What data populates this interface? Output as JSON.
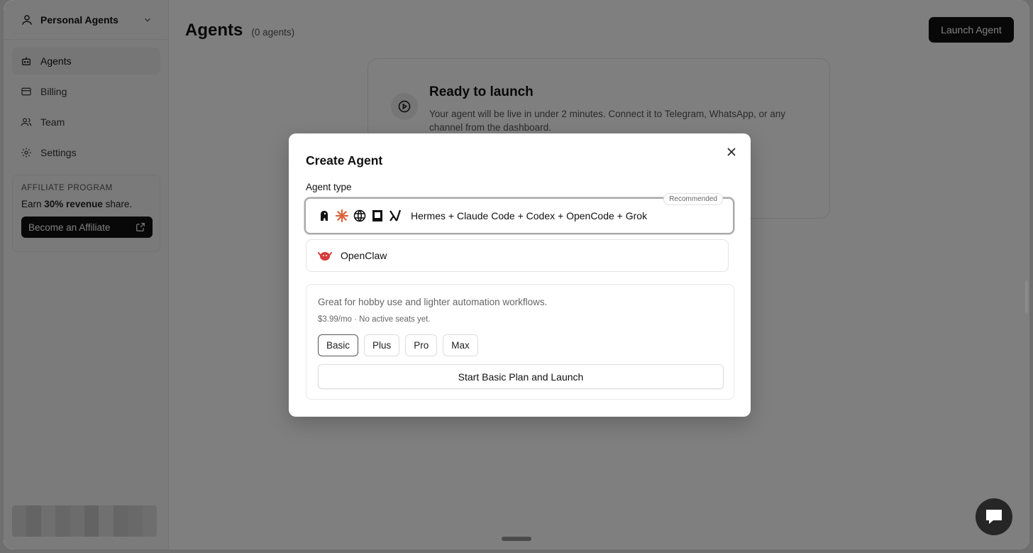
{
  "sidebar": {
    "workspace": "Personal Agents",
    "items": [
      {
        "label": "Agents",
        "icon": "robot-icon"
      },
      {
        "label": "Billing",
        "icon": "credit-card-icon"
      },
      {
        "label": "Team",
        "icon": "users-icon"
      },
      {
        "label": "Settings",
        "icon": "gear-icon"
      }
    ],
    "affiliate": {
      "kicker": "AFFILIATE PROGRAM",
      "text_pre": "Earn ",
      "text_bold": "30% revenue",
      "text_post": " share.",
      "button": "Become an Affiliate"
    }
  },
  "main": {
    "title": "Agents",
    "count": "(0 agents)",
    "launch_button": "Launch Agent",
    "ready_card": {
      "title": "Ready to launch",
      "text": "Your agent will be live in under 2 minutes. Connect it to Telegram, WhatsApp, or any channel from the dashboard."
    }
  },
  "modal": {
    "title": "Create Agent",
    "field_label": "Agent type",
    "options": [
      {
        "label": "Hermes + Claude Code + Codex + OpenCode + Grok",
        "badge": "Recommended",
        "selected": true
      },
      {
        "label": "OpenClaw",
        "selected": false
      }
    ],
    "plan": {
      "description": "Great for hobby use and lighter automation workflows.",
      "price": "$3.99/mo · No active seats yet.",
      "tabs": [
        "Basic",
        "Plus",
        "Pro",
        "Max"
      ],
      "active_tab": "Basic",
      "cta": "Start Basic Plan and Launch"
    }
  }
}
